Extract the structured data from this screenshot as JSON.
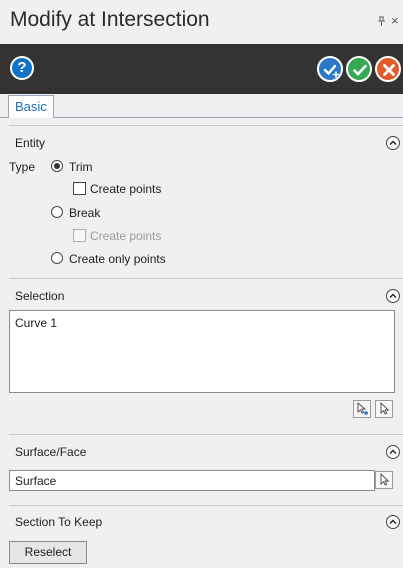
{
  "window": {
    "title": "Modify at Intersection",
    "pin_glyph": "̄",
    "close_glyph": "×"
  },
  "toolbar": {
    "help_label": "?"
  },
  "tabs": [
    {
      "label": "Basic",
      "active": true
    }
  ],
  "entity": {
    "title": "Entity",
    "type_label": "Type",
    "options": [
      {
        "label": "Trim",
        "selected": true
      },
      {
        "label": "Break",
        "selected": false
      },
      {
        "label": "Create only points",
        "selected": false
      }
    ],
    "trim_create_points": {
      "label": "Create points",
      "checked": false,
      "enabled": true
    },
    "break_create_points": {
      "label": "Create points",
      "checked": false,
      "enabled": false
    }
  },
  "selection": {
    "title": "Selection",
    "items": [
      "Curve 1"
    ]
  },
  "surface": {
    "title": "Surface/Face",
    "value": "Surface"
  },
  "section_to_keep": {
    "title": "Section To Keep",
    "reselect_label": "Reselect"
  },
  "colors": {
    "toolbar_bg": "#333333",
    "accent_blue": "#1a6fbf",
    "ok_green": "#34a853",
    "cancel_orange": "#e25b2a"
  }
}
